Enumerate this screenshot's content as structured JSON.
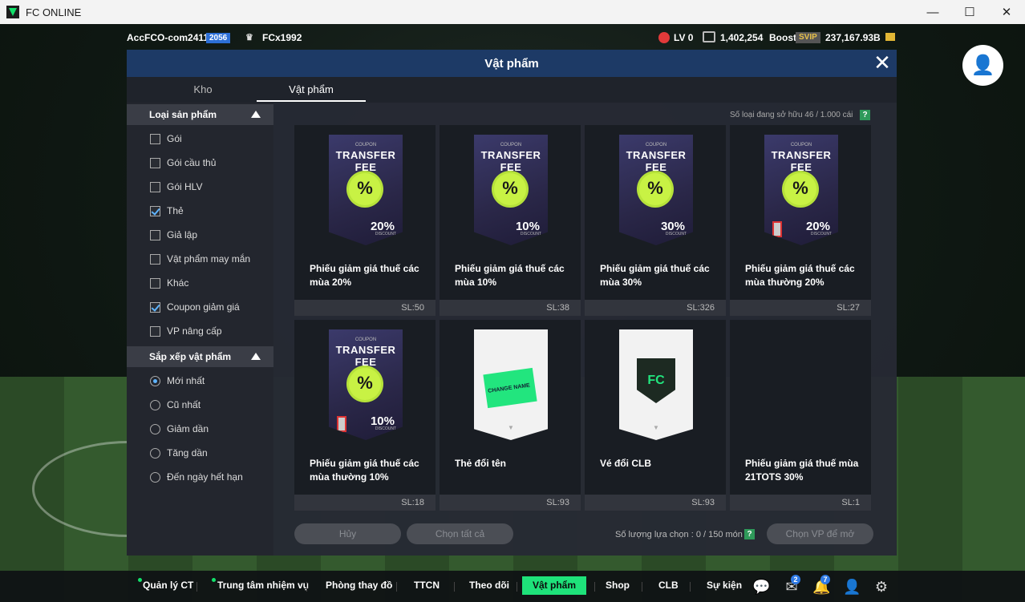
{
  "window": {
    "title": "FC ONLINE",
    "controls": [
      "—",
      "☐",
      "✕"
    ]
  },
  "topbar": {
    "account_name": "AccFCO-com2411t",
    "ovr": "2056",
    "club_name": "FCx1992",
    "level": "LV 0",
    "coins": "1,402,254",
    "boost_label": "Boost",
    "svip_label": "SVIP",
    "bp": "237,167.93B"
  },
  "modal": {
    "title": "Vật phẩm",
    "close_symbol": "✕",
    "tabs": [
      "Kho",
      "Vật phẩm"
    ],
    "active_tab": "Vật phẩm"
  },
  "sidebar": {
    "product_type_heading": "Loại sản phẩm",
    "product_types": [
      {
        "label": "Gói",
        "checked": false
      },
      {
        "label": "Gói cầu thủ",
        "checked": false
      },
      {
        "label": "Gói HLV",
        "checked": false
      },
      {
        "label": "Thẻ",
        "checked": true
      },
      {
        "label": "Giả lập",
        "checked": false
      },
      {
        "label": "Vật phẩm may mắn",
        "checked": false
      },
      {
        "label": "Khác",
        "checked": false
      },
      {
        "label": "Coupon giảm giá",
        "checked": true
      },
      {
        "label": "VP nâng cấp",
        "checked": false
      }
    ],
    "sort_heading": "Sắp xếp vật phẩm",
    "sort_options": [
      {
        "label": "Mới nhất",
        "selected": true
      },
      {
        "label": "Cũ nhất",
        "selected": false
      },
      {
        "label": "Giảm dần",
        "selected": false
      },
      {
        "label": "Tăng dần",
        "selected": false
      },
      {
        "label": "Đến ngày hết hạn",
        "selected": false
      }
    ]
  },
  "content": {
    "owned_label": "Số loại đang sở hữu  46 / 1.000 cái",
    "help_symbol": "?",
    "items": [
      {
        "name": "Phiếu giảm giá thuế các mùa 20%",
        "qty": "SL:50",
        "art": "coupon",
        "coupon_top": "COUPON",
        "coupon_title": "TRANSFER FEE",
        "seal": "%",
        "pct": "20%",
        "disc": "DISCOUNT",
        "locked": false
      },
      {
        "name": "Phiếu giảm giá thuế các mùa 10%",
        "qty": "SL:38",
        "art": "coupon",
        "coupon_top": "COUPON",
        "coupon_title": "TRANSFER FEE",
        "seal": "%",
        "pct": "10%",
        "disc": "DISCOUNT",
        "locked": false
      },
      {
        "name": "Phiếu giảm giá thuế các mùa 30%",
        "qty": "SL:326",
        "art": "coupon",
        "coupon_top": "COUPON",
        "coupon_title": "TRANSFER FEE",
        "seal": "%",
        "pct": "30%",
        "disc": "DISCOUNT",
        "locked": false
      },
      {
        "name": "Phiếu giảm giá thuế các mùa thường 20%",
        "qty": "SL:27",
        "art": "coupon",
        "coupon_top": "COUPON",
        "coupon_title": "TRANSFER FEE",
        "seal": "%",
        "pct": "20%",
        "disc": "DISCOUNT",
        "locked": true
      },
      {
        "name": "Phiếu giảm giá thuế các mùa thường 10%",
        "qty": "SL:18",
        "art": "coupon",
        "coupon_top": "COUPON",
        "coupon_title": "TRANSFER FEE",
        "seal": "%",
        "pct": "10%",
        "disc": "DISCOUNT",
        "locked": true
      },
      {
        "name": "Thẻ đổi tên",
        "qty": "SL:93",
        "art": "rename",
        "ticket_text": "CHANGE NAME"
      },
      {
        "name": "Vé đổi CLB",
        "qty": "SL:93",
        "art": "club"
      },
      {
        "name": "Phiếu giảm giá thuế mùa 21TOTS 30%",
        "qty": "SL:1",
        "art": "none"
      }
    ],
    "cancel_label": "Hủy",
    "select_all_label": "Chọn tất cả",
    "selection_count": "Số lượng lựa chọn : 0 / 150 món",
    "choose_label": "Chọn VP để mở"
  },
  "bottom_nav": {
    "items": [
      "Quản lý CT",
      "Trung tâm nhiệm vụ",
      "Phòng thay đồ",
      "TTCN",
      "Theo dõi",
      "Vật phẩm",
      "Shop",
      "CLB",
      "Sự kiện"
    ],
    "active": "Vật phẩm",
    "mail_badge": "2",
    "notif_badge": "7"
  },
  "colors": {
    "accent_green": "#1ee27a",
    "modal_header": "#1d3a66",
    "checkbox_blue": "#5fb4ff"
  }
}
